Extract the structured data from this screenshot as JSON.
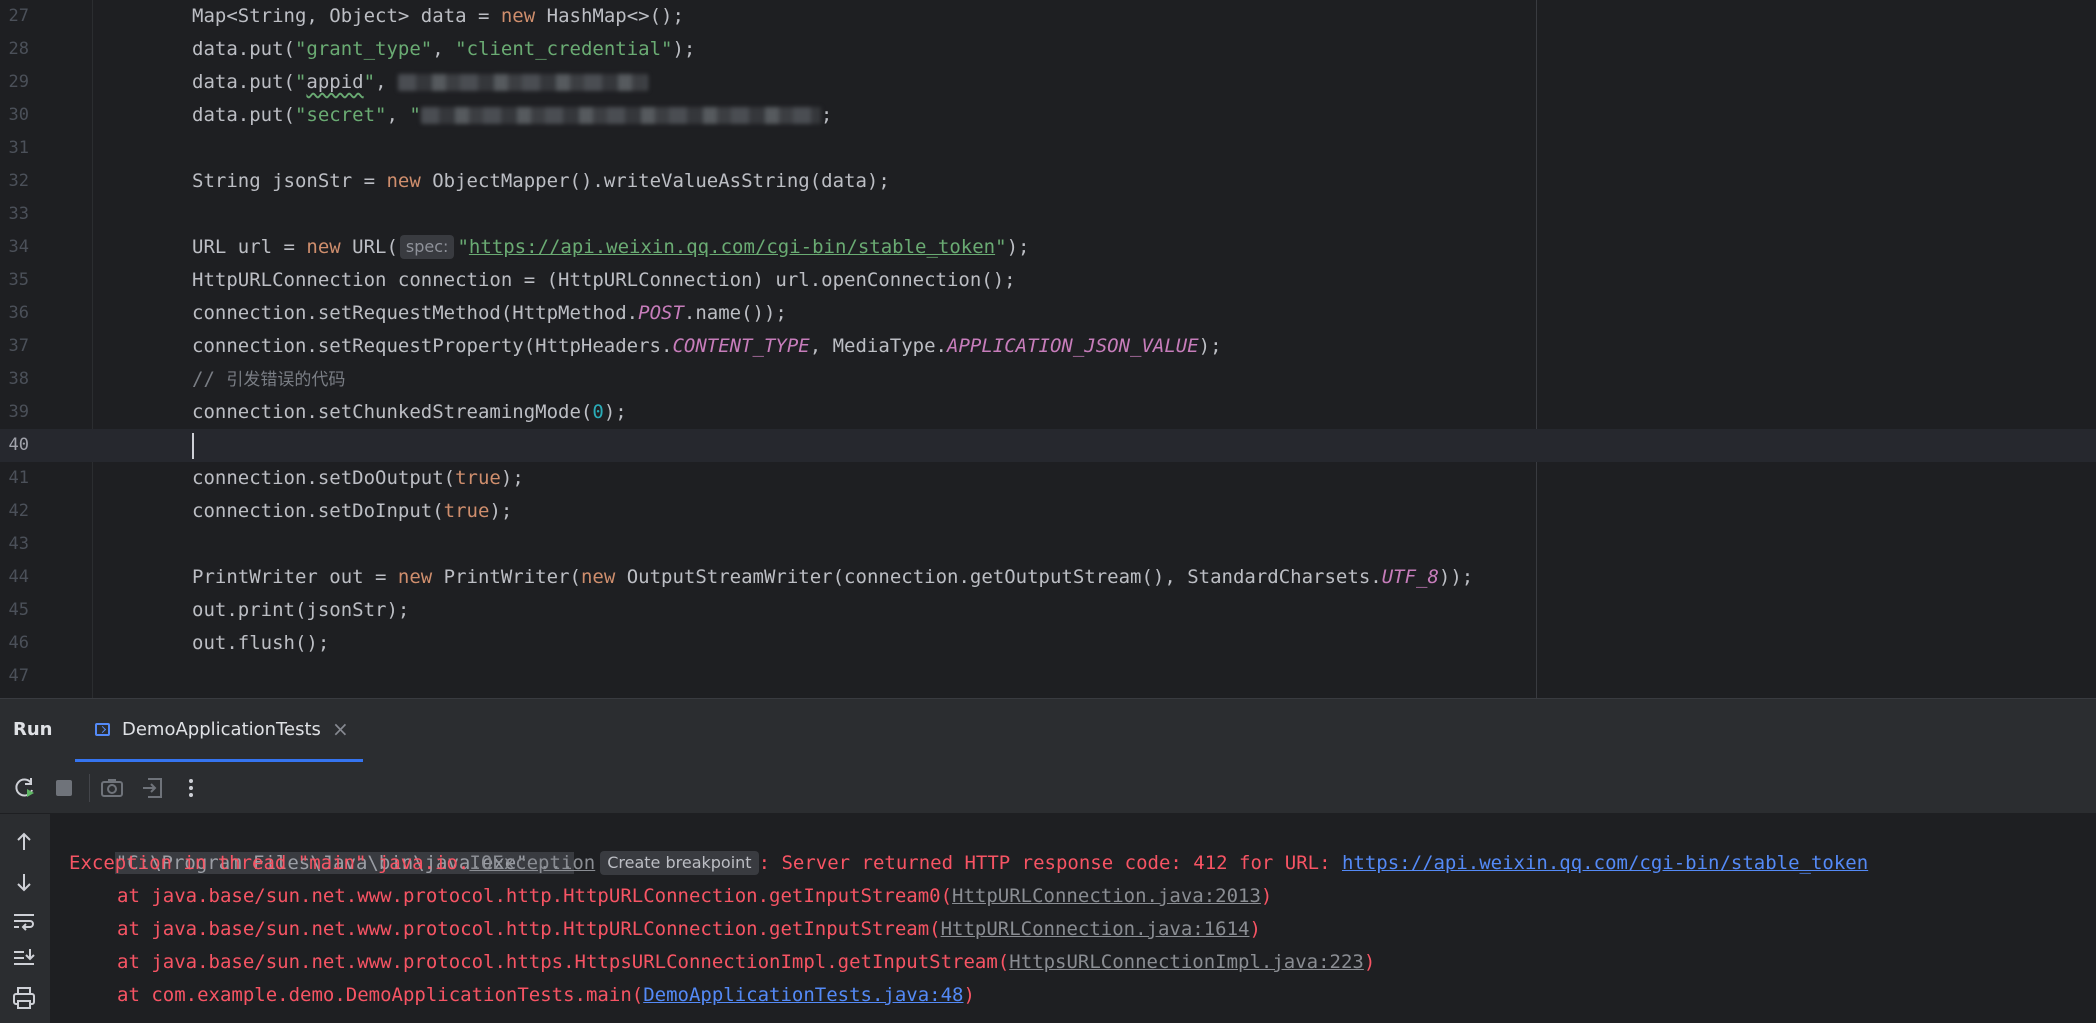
{
  "editor": {
    "lines": [
      {
        "n": "27",
        "tokens": [
          [
            "",
            "Map<String, Object> data = "
          ],
          [
            "kw",
            "new"
          ],
          [
            "",
            " HashMap<>();"
          ]
        ]
      },
      {
        "n": "28",
        "tokens": [
          [
            "",
            "data.put("
          ],
          [
            "str",
            "\"grant_type\""
          ],
          [
            "",
            ", "
          ],
          [
            "str",
            "\"client_credential\""
          ],
          [
            "",
            ");"
          ]
        ]
      },
      {
        "n": "29",
        "tokens": [
          [
            "",
            "data.put("
          ],
          [
            "str",
            "\""
          ],
          [
            "squiggle",
            "appid"
          ],
          [
            "str",
            "\""
          ],
          [
            "",
            ", "
          ],
          [
            "blur",
            "250"
          ]
        ]
      },
      {
        "n": "30",
        "tokens": [
          [
            "",
            "data.put("
          ],
          [
            "str",
            "\"secret\""
          ],
          [
            "",
            ", "
          ],
          [
            "str",
            "\""
          ],
          [
            "blur",
            "400"
          ],
          [
            "",
            ";"
          ]
        ]
      },
      {
        "n": "31",
        "tokens": []
      },
      {
        "n": "32",
        "tokens": [
          [
            "",
            "String jsonStr = "
          ],
          [
            "kw",
            "new"
          ],
          [
            "",
            " ObjectMapper().writeValueAsString(data);"
          ]
        ]
      },
      {
        "n": "33",
        "tokens": []
      },
      {
        "n": "34",
        "tokens": [
          [
            "",
            "URL url = "
          ],
          [
            "kw",
            "new"
          ],
          [
            "",
            " URL("
          ],
          [
            "hint",
            "spec:"
          ],
          [
            "str",
            "\""
          ],
          [
            "link",
            "https://api.weixin.qq.com/cgi-bin/stable_token"
          ],
          [
            "str",
            "\""
          ],
          [
            "",
            ");"
          ]
        ]
      },
      {
        "n": "35",
        "tokens": [
          [
            "",
            "HttpURLConnection connection = (HttpURLConnection) url.openConnection();"
          ]
        ]
      },
      {
        "n": "36",
        "tokens": [
          [
            "",
            "connection.setRequestMethod(HttpMethod."
          ],
          [
            "const",
            "POST"
          ],
          [
            "",
            ".name());"
          ]
        ]
      },
      {
        "n": "37",
        "tokens": [
          [
            "",
            "connection.setRequestProperty(HttpHeaders."
          ],
          [
            "const",
            "CONTENT_TYPE"
          ],
          [
            "",
            ", MediaType."
          ],
          [
            "const",
            "APPLICATION_JSON_VALUE"
          ],
          [
            "",
            ");"
          ]
        ]
      },
      {
        "n": "38",
        "tokens": [
          [
            "cmt",
            "// "
          ],
          [
            "cmt cmt-cn",
            "引发错误的代码"
          ]
        ]
      },
      {
        "n": "39",
        "tokens": [
          [
            "",
            "connection.setChunkedStreamingMode("
          ],
          [
            "num",
            "0"
          ],
          [
            "",
            ");"
          ]
        ]
      },
      {
        "n": "40",
        "tokens": [
          [
            "caret",
            ""
          ]
        ],
        "current": true
      },
      {
        "n": "41",
        "tokens": [
          [
            "",
            "connection.setDoOutput("
          ],
          [
            "kw",
            "true"
          ],
          [
            "",
            ");"
          ]
        ]
      },
      {
        "n": "42",
        "tokens": [
          [
            "",
            "connection.setDoInput("
          ],
          [
            "kw",
            "true"
          ],
          [
            "",
            ");"
          ]
        ]
      },
      {
        "n": "43",
        "tokens": []
      },
      {
        "n": "44",
        "tokens": [
          [
            "",
            "PrintWriter out = "
          ],
          [
            "kw",
            "new"
          ],
          [
            "",
            " PrintWriter("
          ],
          [
            "kw",
            "new"
          ],
          [
            "",
            " OutputStreamWriter(connection.getOutputStream(), StandardCharsets."
          ],
          [
            "const",
            "UTF_8"
          ],
          [
            "",
            "));"
          ]
        ]
      },
      {
        "n": "45",
        "tokens": [
          [
            "",
            "out.print(jsonStr);"
          ]
        ]
      },
      {
        "n": "46",
        "tokens": [
          [
            "",
            "out.flush();"
          ]
        ]
      },
      {
        "n": "47",
        "tokens": []
      }
    ]
  },
  "run_panel": {
    "title": "Run",
    "tab_label": "DemoApplicationTests",
    "tab_close": "×"
  },
  "toolbar": {
    "icons": [
      "rerun-icon",
      "stop-icon",
      "screenshot-icon",
      "exit-icon",
      "more-icon"
    ]
  },
  "rail": {
    "icons": [
      "scroll-up-icon",
      "scroll-down-icon",
      "soft-wrap-icon",
      "scroll-to-end-icon",
      "print-icon"
    ]
  },
  "console": {
    "cmd": "\"C:\\Program Files\\Java\\bin\\java.exe\" ...",
    "exception_prefix": "Exception in thread \"main\" java.io.",
    "exception_type": "IOException",
    "breakpoint_chip": "Create breakpoint",
    "exception_message": ": Server returned HTTP response code: 412 for URL: ",
    "exception_url": "https://api.weixin.qq.com/cgi-bin/stable_token",
    "stack": [
      {
        "prefix": "at java.base/sun.net.www.protocol.http.HttpURLConnection.getInputStream0(",
        "source": "HttpURLConnection.java:2013",
        "suffix": ")",
        "link_style": "src"
      },
      {
        "prefix": "at java.base/sun.net.www.protocol.http.HttpURLConnection.getInputStream(",
        "source": "HttpURLConnection.java:1614",
        "suffix": ")",
        "link_style": "src"
      },
      {
        "prefix": "at java.base/sun.net.www.protocol.https.HttpsURLConnectionImpl.getInputStream(",
        "source": "HttpsURLConnectionImpl.java:223",
        "suffix": ")",
        "link_style": "src"
      },
      {
        "prefix": "at com.example.demo.DemoApplicationTests.main(",
        "source": "DemoApplicationTests.java:48",
        "suffix": ")",
        "link_style": "ulink"
      }
    ]
  },
  "colors": {
    "editor_bg": "#1e1f22",
    "panel_bg": "#2b2d30",
    "keyword": "#cf8e6d",
    "string": "#6aab73",
    "constant": "#c77dbb",
    "error": "#f75464",
    "link": "#548af7",
    "accent": "#3574f0"
  }
}
